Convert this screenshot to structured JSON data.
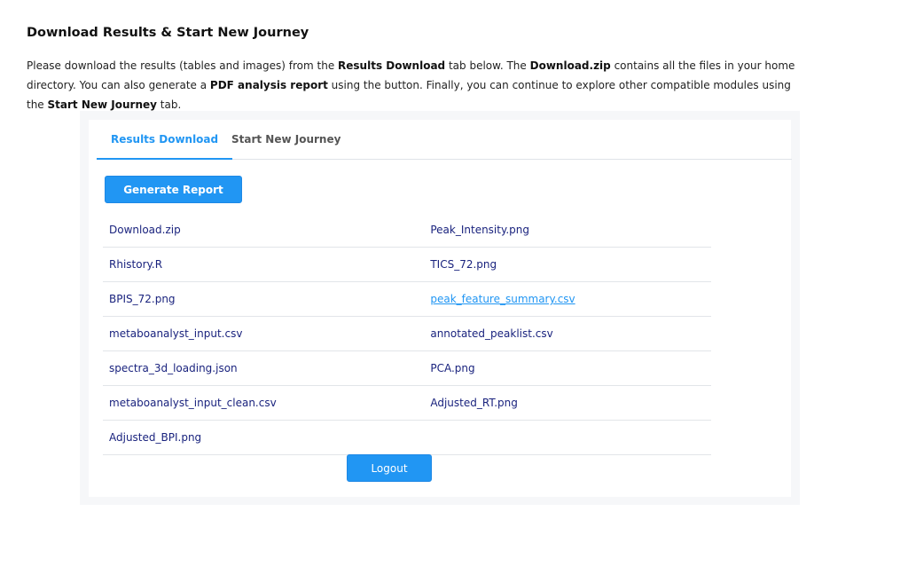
{
  "header": {
    "title": "Download Results & Start New Journey"
  },
  "intro": {
    "p1": "Please download the results (tables and images) from the ",
    "b1": "Results Download",
    "p2": " tab below. The ",
    "b2": "Download.zip",
    "p3": " contains all the files in your home directory. You can also generate a ",
    "b3": "PDF analysis report",
    "p4": " using the button. Finally, you can continue to explore other compatible modules using the ",
    "b4": "Start New Journey",
    "p5": " tab."
  },
  "tabs": [
    {
      "label": "Results Download",
      "active": true
    },
    {
      "label": "Start New Journey",
      "active": false
    }
  ],
  "actions": {
    "generate_report_label": "Generate Report",
    "logout_label": "Logout"
  },
  "files": {
    "rows": [
      [
        "Download.zip",
        "Peak_Intensity.png"
      ],
      [
        "Rhistory.R",
        "TICS_72.png"
      ],
      [
        "BPIS_72.png",
        "peak_feature_summary.csv"
      ],
      [
        "metaboanalyst_input.csv",
        "annotated_peaklist.csv"
      ],
      [
        "spectra_3d_loading.json",
        "PCA.png"
      ],
      [
        "metaboanalyst_input_clean.csv",
        "Adjusted_RT.png"
      ],
      [
        "Adjusted_BPI.png",
        ""
      ]
    ]
  },
  "colors": {
    "accent": "#2196f3",
    "link": "#1a237e",
    "panel_bg": "#f6f7f9"
  }
}
